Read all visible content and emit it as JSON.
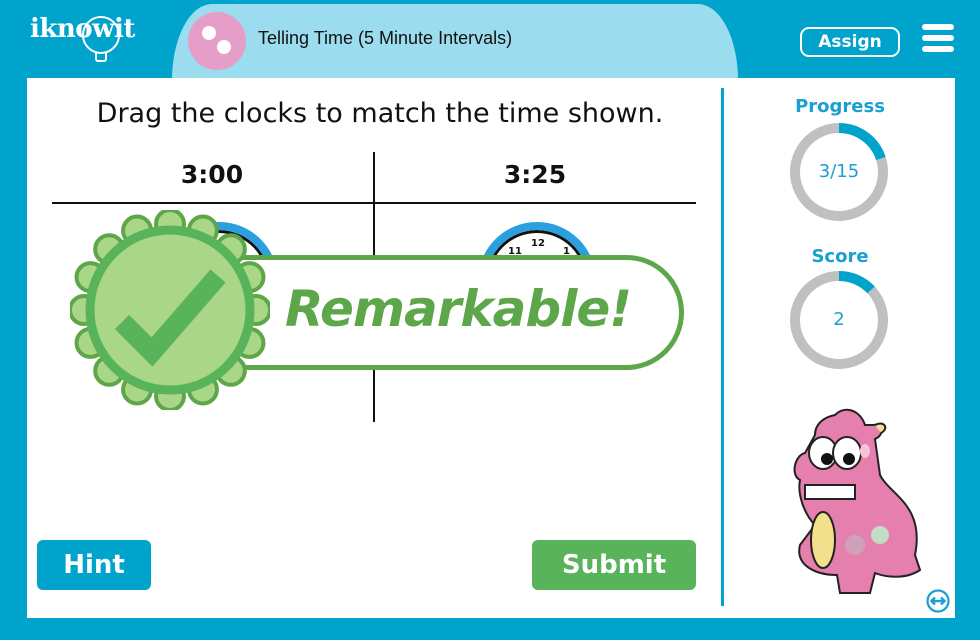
{
  "header": {
    "logo_text": "iknowit",
    "lesson_title": "Telling Time (5 Minute Intervals)",
    "assign_label": "Assign",
    "menu_icon": "hamburger-menu-icon"
  },
  "question": {
    "prompt": "Drag the clocks to match the time shown.",
    "columns": [
      {
        "time_label": "3:00"
      },
      {
        "time_label": "3:25"
      }
    ],
    "clock_numbers_visible": [
      "11",
      "12",
      "1"
    ]
  },
  "feedback": {
    "message": "Remarkable!",
    "icon": "checkmark-badge-icon",
    "color": "#5ea64a"
  },
  "sidebar": {
    "progress": {
      "label": "Progress",
      "value_text": "3/15",
      "current": 3,
      "total": 15
    },
    "score": {
      "label": "Score",
      "value_text": "2",
      "fraction": 0.13
    },
    "mascot": "pink-monster-mascot",
    "expand_icon": "double-arrow-icon"
  },
  "actions": {
    "hint_label": "Hint",
    "submit_label": "Submit"
  },
  "colors": {
    "brand_blue": "#00a3cc",
    "title_bar": "#9bdcee",
    "submit_green": "#58b35b",
    "ring_track": "#c0c0c0",
    "ring_fill": "#00a3cc"
  }
}
